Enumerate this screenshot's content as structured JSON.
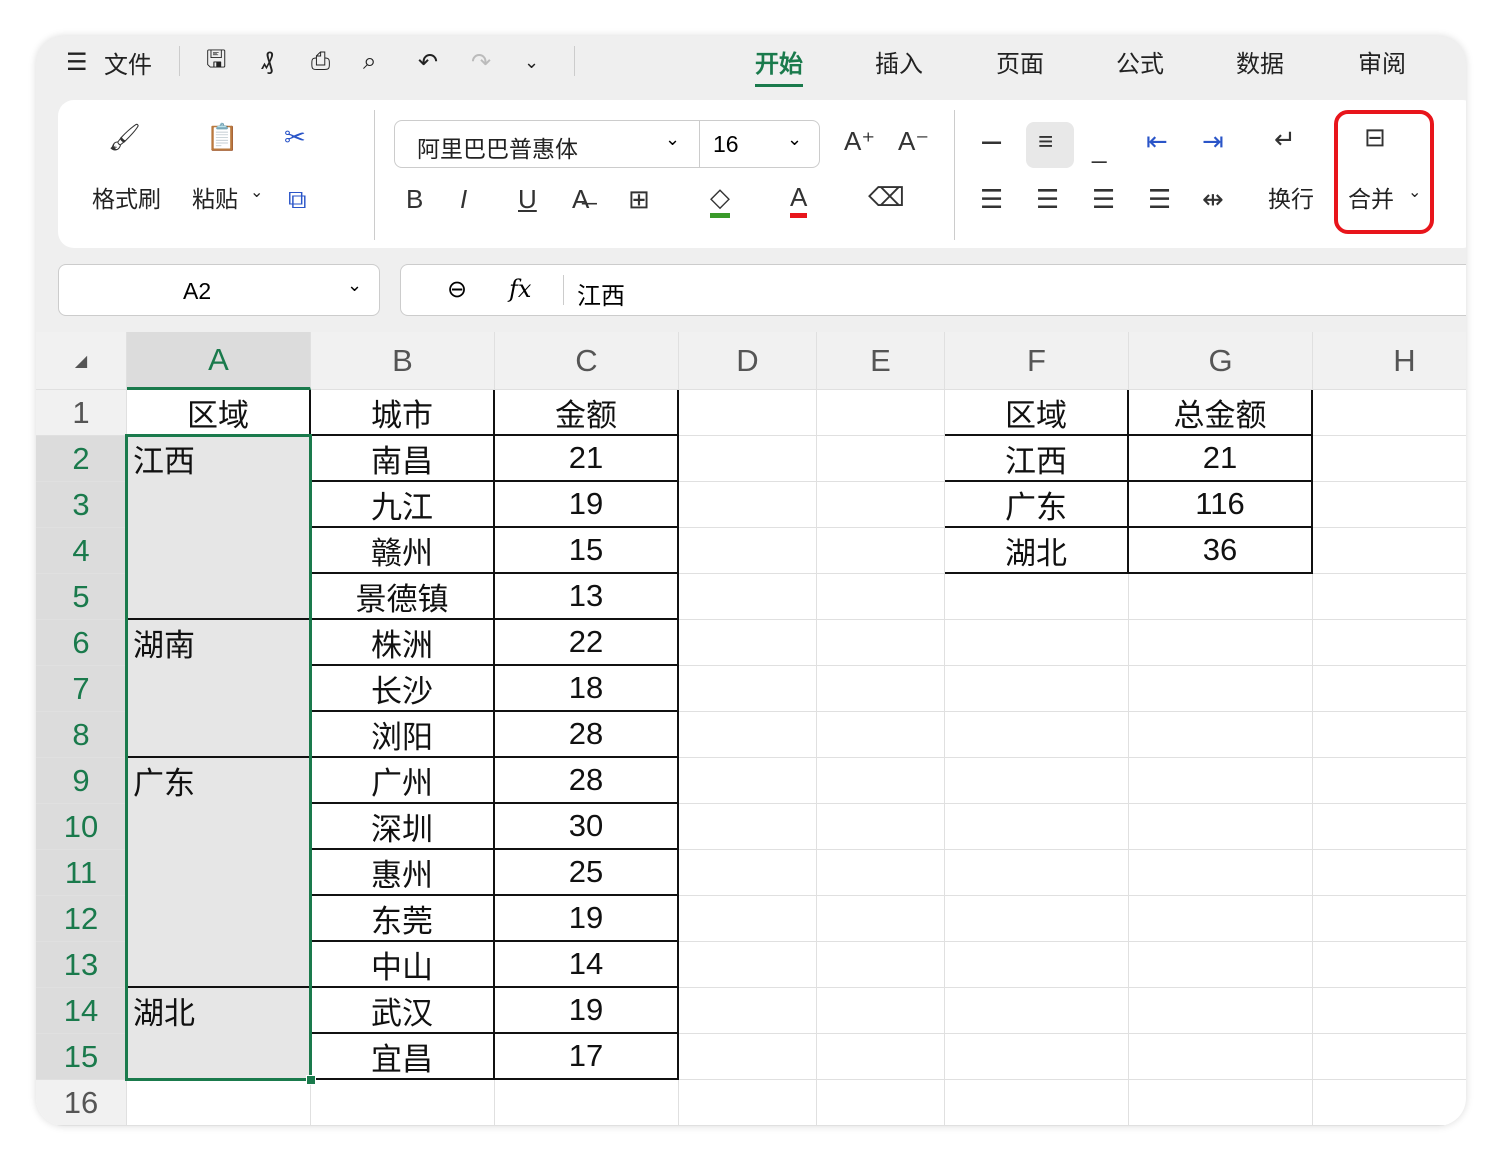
{
  "menu": {
    "file_label": "文件",
    "tabs": [
      "开始",
      "插入",
      "页面",
      "公式",
      "数据",
      "审阅"
    ],
    "active_tab": "开始"
  },
  "ribbon": {
    "format_painter": "格式刷",
    "paste": "粘贴",
    "font_name": "阿里巴巴普惠体",
    "font_size": "16",
    "wrap": "换行",
    "merge": "合并",
    "bold": "B",
    "italic": "I",
    "underline": "U"
  },
  "formula_bar": {
    "cell_ref": "A2",
    "fx": "fx",
    "value": "江西"
  },
  "colors": {
    "accent": "#1a7a4c",
    "highlight": "#e8151b",
    "fill_color": "#3a9a2a",
    "font_color": "#e8151b"
  },
  "sheet": {
    "columns": [
      "A",
      "B",
      "C",
      "D",
      "E",
      "F",
      "G",
      "H"
    ],
    "rows": [
      [
        "区域",
        "城市",
        "金额",
        "",
        "",
        "区域",
        "总金额",
        ""
      ],
      [
        "江西",
        "南昌",
        "21",
        "",
        "",
        "江西",
        "21",
        ""
      ],
      [
        "",
        "九江",
        "19",
        "",
        "",
        "广东",
        "116",
        ""
      ],
      [
        "",
        "赣州",
        "15",
        "",
        "",
        "湖北",
        "36",
        ""
      ],
      [
        "",
        "景德镇",
        "13",
        "",
        "",
        "",
        "",
        ""
      ],
      [
        "湖南",
        "株洲",
        "22",
        "",
        "",
        "",
        "",
        ""
      ],
      [
        "",
        "长沙",
        "18",
        "",
        "",
        "",
        "",
        ""
      ],
      [
        "",
        "浏阳",
        "28",
        "",
        "",
        "",
        "",
        ""
      ],
      [
        "广东",
        "广州",
        "28",
        "",
        "",
        "",
        "",
        ""
      ],
      [
        "",
        "深圳",
        "30",
        "",
        "",
        "",
        "",
        ""
      ],
      [
        "",
        "惠州",
        "25",
        "",
        "",
        "",
        "",
        ""
      ],
      [
        "",
        "东莞",
        "19",
        "",
        "",
        "",
        "",
        ""
      ],
      [
        "",
        "中山",
        "14",
        "",
        "",
        "",
        "",
        ""
      ],
      [
        "湖北",
        "武汉",
        "19",
        "",
        "",
        "",
        "",
        ""
      ],
      [
        "",
        "宜昌",
        "17",
        "",
        "",
        "",
        "",
        ""
      ],
      [
        "",
        "",
        "",
        "",
        "",
        "",
        "",
        ""
      ]
    ]
  }
}
